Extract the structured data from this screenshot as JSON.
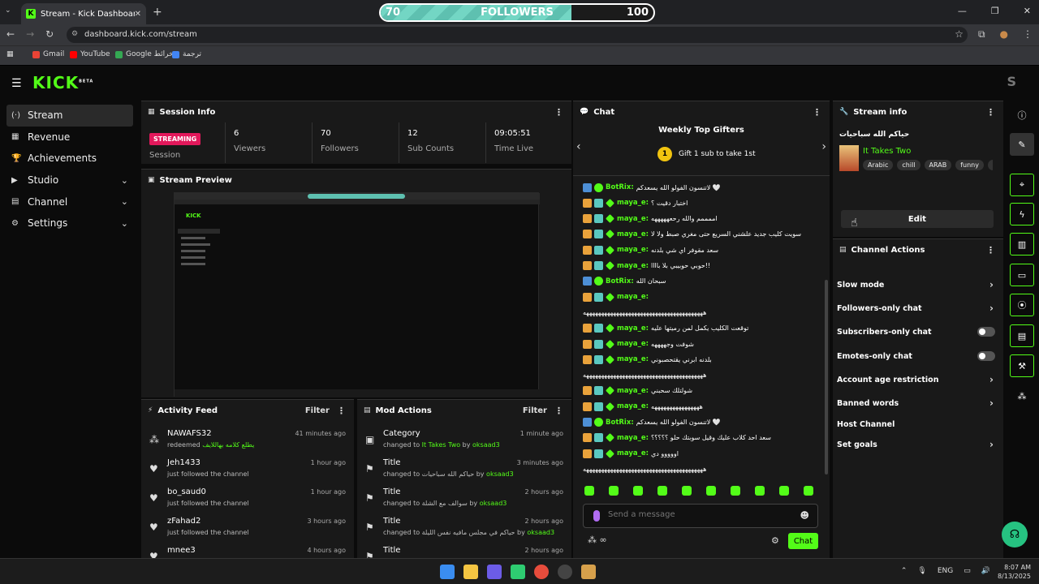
{
  "browser": {
    "tab_title": "Stream - Kick Dashboard",
    "url": "dashboard.kick.com/stream",
    "bookmarks": [
      "Gmail",
      "YouTube",
      "Google خرائط",
      "ترجمة"
    ]
  },
  "followers_goal": {
    "current": "70",
    "label": "FOLLOWERS",
    "target": "100",
    "progress": 0.7
  },
  "app": {
    "logo": "KICK",
    "logo_sup": "BETA",
    "avatar_letter": "S"
  },
  "sidebar": [
    {
      "label": "Stream",
      "icon": "(·)",
      "chev": ""
    },
    {
      "label": "Revenue",
      "icon": "▦",
      "chev": ""
    },
    {
      "label": "Achievements",
      "icon": "🏆",
      "chev": ""
    },
    {
      "label": "Studio",
      "icon": "▶",
      "chev": "⌄"
    },
    {
      "label": "Channel",
      "icon": "▤",
      "chev": "⌄"
    },
    {
      "label": "Settings",
      "icon": "⚙",
      "chev": "⌄"
    }
  ],
  "session": {
    "title": "Session Info",
    "status": "STREAMING",
    "status_label": "Session",
    "stats": [
      {
        "value": "6",
        "label": "Viewers"
      },
      {
        "value": "70",
        "label": "Followers"
      },
      {
        "value": "12",
        "label": "Sub Counts"
      },
      {
        "value": "09:05:51",
        "label": "Time Live"
      }
    ]
  },
  "preview": {
    "title": "Stream Preview"
  },
  "activity": {
    "title": "Activity Feed",
    "filter": "Filter",
    "items": [
      {
        "icon": "⁂",
        "name": "NAWAFS32",
        "sub": "redeemed",
        "sub_green": "يطلع كلامه بهاللايف",
        "time": "41 minutes ago"
      },
      {
        "icon": "♥",
        "name": "Jeh1433",
        "sub": "just followed the channel",
        "sub_green": "",
        "time": "1 hour ago"
      },
      {
        "icon": "♥",
        "name": "bo_saud0",
        "sub": "just followed the channel",
        "sub_green": "",
        "time": "1 hour ago"
      },
      {
        "icon": "♥",
        "name": "zFahad2",
        "sub": "just followed the channel",
        "sub_green": "",
        "time": "3 hours ago"
      },
      {
        "icon": "♥",
        "name": "mnee3",
        "sub": "",
        "sub_green": "",
        "time": "4 hours ago"
      }
    ]
  },
  "mod_actions": {
    "title": "Mod Actions",
    "filter": "Filter",
    "items": [
      {
        "icon": "▣",
        "name": "Category",
        "prefix": "changed to",
        "value": "It Takes Two",
        "by": "by",
        "user": "oksaad3",
        "time": "1 minute ago"
      },
      {
        "icon": "⚑",
        "name": "Title",
        "prefix": "changed to",
        "value": "حياكم الله سباحيات",
        "by": "by",
        "user": "oksaad3",
        "time": "3 minutes ago"
      },
      {
        "icon": "⚑",
        "name": "Title",
        "prefix": "changed to",
        "value": "سوالف مع الشلة",
        "by": "by",
        "user": "oksaad3",
        "time": "2 hours ago"
      },
      {
        "icon": "⚑",
        "name": "Title",
        "prefix": "changed to",
        "value": "حياكم في مجلس مافيه نفس الليلة",
        "by": "by",
        "user": "oksaad3",
        "time": "2 hours ago"
      },
      {
        "icon": "⚑",
        "name": "Title",
        "prefix": "",
        "value": "",
        "by": "",
        "user": "",
        "time": "2 hours ago"
      }
    ]
  },
  "chat": {
    "title": "Chat",
    "gifters_title": "Weekly Top Gifters",
    "gifter_rank": "1",
    "gifter_msg": "Gift 1 sub to take 1st",
    "placeholder": "Send a message",
    "send_label": "Chat",
    "messages": [
      {
        "badges": [
          "kick",
          "ver"
        ],
        "user": "BotRix",
        "color": "#53fc18",
        "text": "لاتنسون الفولو الله يسعدكم 🤍"
      },
      {
        "badges": [
          "crown",
          "sub",
          "star"
        ],
        "user": "maya_e",
        "color": "#53fc18",
        "text": "اختبار دقيت ؟"
      },
      {
        "badges": [
          "crown",
          "sub",
          "star"
        ],
        "user": "maya_e",
        "color": "#53fc18",
        "text": "اممممم والله رحعهههههه"
      },
      {
        "badges": [
          "crown",
          "sub",
          "star"
        ],
        "user": "maya_e",
        "color": "#53fc18",
        "text": "سويت كليب جديد علشني السريع حتى مغري صبط ولا لا"
      },
      {
        "badges": [
          "crown",
          "sub",
          "star"
        ],
        "user": "maya_e",
        "color": "#53fc18",
        "text": "سعد مقوفر اي شي بلدنه"
      },
      {
        "badges": [
          "crown",
          "sub",
          "star"
        ],
        "user": "maya_e",
        "color": "#53fc18",
        "text": "حوبي حوبيبي بلا باااا!!"
      },
      {
        "badges": [
          "kick",
          "ver"
        ],
        "user": "BotRix",
        "color": "#53fc18",
        "text": "سبحان الله"
      },
      {
        "badges": [
          "crown",
          "sub",
          "star"
        ],
        "user": "maya_e",
        "color": "#53fc18",
        "text": ""
      },
      {
        "badges": [],
        "user": "",
        "color": "#fff",
        "text": "ههههههههههههههههههههههههههههههههههههههههه"
      },
      {
        "badges": [
          "crown",
          "sub",
          "star"
        ],
        "user": "maya_e",
        "color": "#53fc18",
        "text": "توقعت الكليب يكمل لمن رميتها عليه"
      },
      {
        "badges": [
          "crown",
          "sub",
          "star"
        ],
        "user": "maya_e",
        "color": "#53fc18",
        "text": "شوفت وجههههه"
      },
      {
        "badges": [
          "crown",
          "sub",
          "star"
        ],
        "user": "maya_e",
        "color": "#53fc18",
        "text": "بلدنه ابرني يقتحصبوني"
      },
      {
        "badges": [],
        "user": "",
        "color": "#fff",
        "text": "ههههههههههههههههههههههههههههههههههههههههه"
      },
      {
        "badges": [
          "crown",
          "sub",
          "star"
        ],
        "user": "maya_e",
        "color": "#53fc18",
        "text": "شولتلك سحبني"
      },
      {
        "badges": [
          "crown",
          "sub",
          "star"
        ],
        "user": "maya_e",
        "color": "#53fc18",
        "text": "ههههههههههههههههه"
      },
      {
        "badges": [
          "kick",
          "ver"
        ],
        "user": "BotRix",
        "color": "#53fc18",
        "text": "لاتنسون الفولو الله يسعدكم 🤍"
      },
      {
        "badges": [
          "crown",
          "sub",
          "star"
        ],
        "user": "maya_e",
        "color": "#53fc18",
        "text": "سعد احد كلاب عليك وقيل سوبتك حلو ؟؟؟؟؟"
      },
      {
        "badges": [
          "crown",
          "sub",
          "star"
        ],
        "user": "maya_e",
        "color": "#53fc18",
        "text": "اووووو دي"
      },
      {
        "badges": [],
        "user": "",
        "color": "#fff",
        "text": "ههههههههههههههههههههههههههههههههههههههههه"
      }
    ]
  },
  "stream_info": {
    "title": "Stream info",
    "stream_title": "حياكم الله سباحيات",
    "category": "It Takes Two",
    "tags": [
      "Arabic",
      "chill",
      "ARAB",
      "funny",
      "ca"
    ],
    "edit_label": "Edit"
  },
  "channel_actions": {
    "title": "Channel Actions",
    "items": [
      {
        "label": "Slow mode",
        "kind": "chev"
      },
      {
        "label": "Followers-only chat",
        "kind": "chev"
      },
      {
        "label": "Subscribers-only chat",
        "kind": "toggle"
      },
      {
        "label": "Emotes-only chat",
        "kind": "toggle"
      },
      {
        "label": "Account age restriction",
        "kind": "chev"
      },
      {
        "label": "Banned words",
        "kind": "chev"
      },
      {
        "label": "Host Channel",
        "kind": "none"
      },
      {
        "label": "Set goals",
        "kind": "chev"
      }
    ]
  },
  "taskbar": {
    "lang": "ENG",
    "time": "8:07 AM",
    "date": "8/13/2025"
  },
  "colors": {
    "accent": "#53fc18",
    "live": "#e2185b",
    "panel": "#191919"
  }
}
